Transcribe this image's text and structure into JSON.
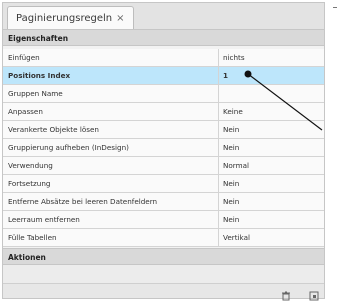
{
  "tab": {
    "label": "Paginierungsregeln",
    "close_glyph": "×"
  },
  "sections": {
    "properties": "Eigenschaften",
    "actions": "Aktionen"
  },
  "properties": [
    {
      "name": "Einfügen",
      "value": "nichts"
    },
    {
      "name": "Positions Index",
      "value": "1",
      "selected": true
    },
    {
      "name": "Gruppen Name",
      "value": ""
    },
    {
      "name": "Anpassen",
      "value": "Keine"
    },
    {
      "name": "Verankerte Objekte lösen",
      "value": "Nein"
    },
    {
      "name": "Gruppierung aufheben (InDesign)",
      "value": "Nein"
    },
    {
      "name": "Verwendung",
      "value": "Normal"
    },
    {
      "name": "Fortsetzung",
      "value": "Nein"
    },
    {
      "name": "Entferne Absätze bei leeren Datenfeldern",
      "value": "Nein"
    },
    {
      "name": "Leerraum entfernen",
      "value": "Nein"
    },
    {
      "name": "Fülle Tabellen",
      "value": "Vertikal"
    }
  ],
  "icons": {
    "delete": "trash-icon",
    "new": "new-item-icon"
  },
  "colors": {
    "selection": "#bde6fb",
    "section": "#d9d9d9"
  }
}
